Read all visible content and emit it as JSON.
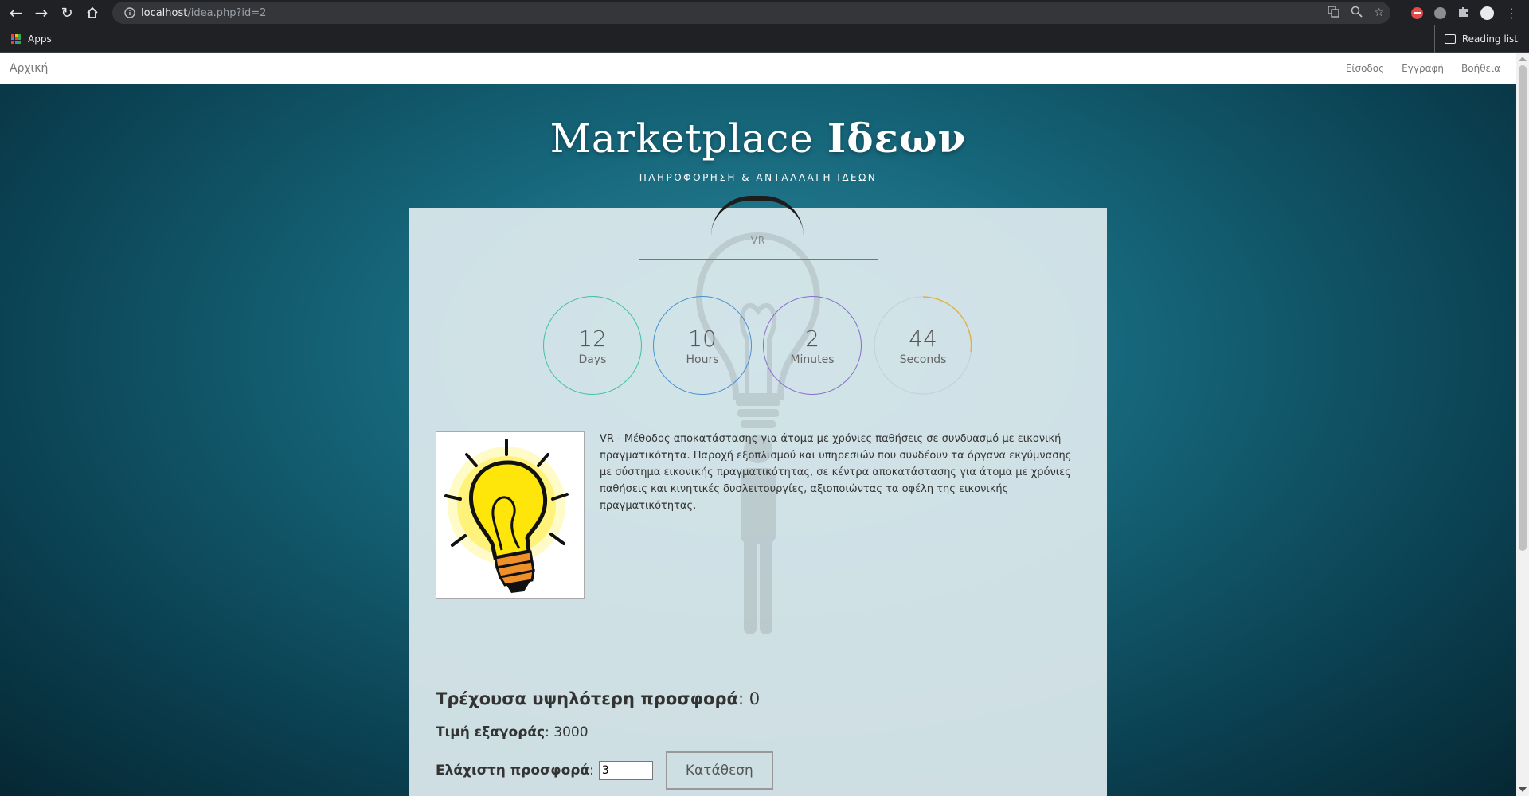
{
  "browser": {
    "url_host": "localhost",
    "url_path": "/idea.php?id=2",
    "bookmarks": {
      "apps_label": "Apps",
      "reading_list_label": "Reading list"
    }
  },
  "site": {
    "brand": "Αρχική",
    "nav": {
      "login": "Είσοδος",
      "register": "Εγγραφή",
      "help": "Βοήθεια"
    }
  },
  "hero": {
    "title_regular": "Marketplace",
    "title_bold": "Ιδεων",
    "subtitle": "ΠΛΗΡΟΦΟΡΗΣΗ & ΑΝΤΑΛΛΑΓΗ ΙΔΕΩΝ"
  },
  "idea": {
    "title": "VR",
    "description": "VR - Μέθοδος αποκατάστασης για άτομα με χρόνιες παθήσεις σε συνδυασμό με εικονική πραγματικότητα. Παροχή εξοπλισμού και υπηρεσιών που συνδέουν τα όργανα εκγύμνασης με σύστημα εικονικής πραγματικότητας, σε κέντρα αποκατάστασης για άτομα με χρόνιες παθήσεις και κινητικές δυσλειτουργίες, αξιοποιώντας τα οφέλη της εικονικής πραγματικότητας.",
    "image_icon": "lightbulb-icon"
  },
  "countdown": {
    "days": {
      "value": "12",
      "label": "Days",
      "color": "#3fbfa9"
    },
    "hours": {
      "value": "10",
      "label": "Hours",
      "color": "#4a8fd0"
    },
    "minutes": {
      "value": "2",
      "label": "Minutes",
      "color": "#8a6cc9"
    },
    "seconds": {
      "value": "44",
      "label": "Seconds",
      "color": "#e3b23c"
    }
  },
  "bidding": {
    "current_label": "Τρέχουσα υψηλότερη προσφορά",
    "current_value": "0",
    "buyout_label": "Τιμή εξαγοράς",
    "buyout_value": "3000",
    "min_label": "Ελάχιστη προσφορά",
    "min_value": "3",
    "submit_label": "Κατάθεση"
  }
}
